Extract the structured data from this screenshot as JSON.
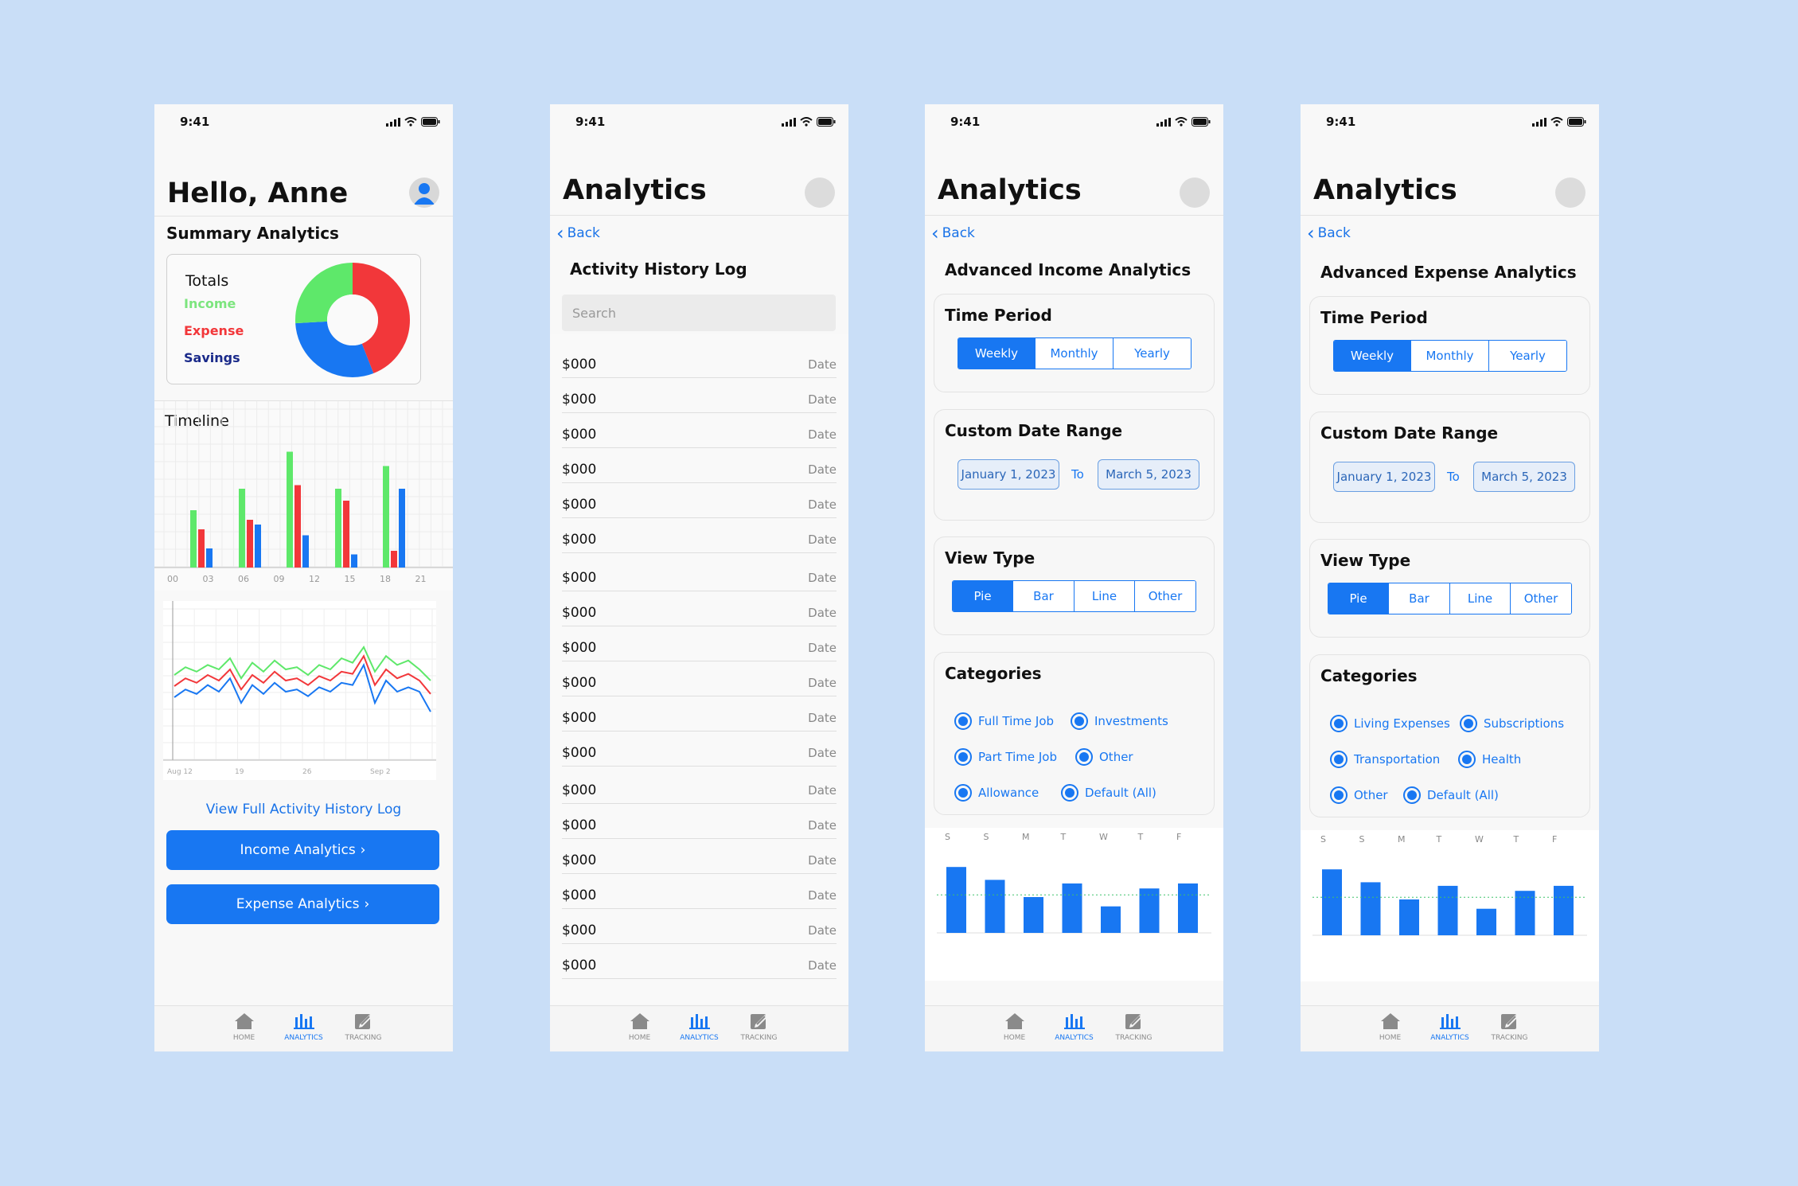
{
  "status_time": "9:41",
  "nav": {
    "home": "HOME",
    "analytics": "ANALYTICS",
    "tracking": "TRACKING"
  },
  "back_label": "Back",
  "colors": {
    "accent": "#1877f2",
    "income": "#5ee86a",
    "expense": "#f2373a",
    "savings": "#1877f2",
    "savings_label": "#1a2a8a",
    "background": "#c9def7"
  },
  "home": {
    "greeting": "Hello, Anne",
    "summary_title": "Summary Analytics",
    "totals": "Totals",
    "legend": {
      "income": "Income",
      "expense": "Expense",
      "savings": "Savings"
    },
    "timeline_title": "Timeline",
    "view_log_link": "View Full Activity History Log",
    "income_btn": "Income Analytics",
    "expense_btn": "Expense Analytics"
  },
  "log": {
    "title": "Analytics",
    "subtitle": "Activity History Log",
    "search_placeholder": "Search",
    "rows": [
      {
        "amount": "$000",
        "date": "Date"
      },
      {
        "amount": "$000",
        "date": "Date"
      },
      {
        "amount": "$000",
        "date": "Date"
      },
      {
        "amount": "$000",
        "date": "Date"
      },
      {
        "amount": "$000",
        "date": "Date"
      },
      {
        "amount": "$000",
        "date": "Date"
      },
      {
        "amount": "$000",
        "date": "Date"
      },
      {
        "amount": "$000",
        "date": "Date"
      },
      {
        "amount": "$000",
        "date": "Date"
      },
      {
        "amount": "$000",
        "date": "Date"
      },
      {
        "amount": "$000",
        "date": "Date"
      },
      {
        "amount": "$000",
        "date": "Date"
      },
      {
        "amount": "$000",
        "date": "Date"
      },
      {
        "amount": "$000",
        "date": "Date"
      },
      {
        "amount": "$000",
        "date": "Date"
      },
      {
        "amount": "$000",
        "date": "Date"
      },
      {
        "amount": "$000",
        "date": "Date"
      },
      {
        "amount": "$000",
        "date": "Date"
      }
    ]
  },
  "income": {
    "title": "Analytics",
    "subtitle": "Advanced Income Analytics",
    "time_period": "Time Period",
    "periods": [
      "Weekly",
      "Monthly",
      "Yearly"
    ],
    "custom_range": "Custom Date Range",
    "date_from": "January 1, 2023",
    "to_label": "To",
    "date_to": "March 5, 2023",
    "view_type": "View Type",
    "views": [
      "Pie",
      "Bar",
      "Line",
      "Other"
    ],
    "categories_title": "Categories",
    "categories": [
      "Full Time Job",
      "Investments",
      "Part Time Job",
      "Other",
      "Allowance",
      "Default (All)"
    ]
  },
  "expense": {
    "title": "Analytics",
    "subtitle": "Advanced Expense Analytics",
    "time_period": "Time Period",
    "periods": [
      "Weekly",
      "Monthly",
      "Yearly"
    ],
    "custom_range": "Custom Date Range",
    "date_from": "January 1, 2023",
    "to_label": "To",
    "date_to": "March 5, 2023",
    "view_type": "View Type",
    "views": [
      "Pie",
      "Bar",
      "Line",
      "Other"
    ],
    "categories_title": "Categories",
    "categories": [
      "Living Expenses",
      "Subscriptions",
      "Transportation",
      "Health",
      "Other",
      "Default (All)"
    ]
  },
  "donut": {
    "income": 26,
    "expense": 44,
    "savings": 30
  },
  "timeline_chart": {
    "type": "bar",
    "categories": [
      "00",
      "03",
      "06",
      "09",
      "12",
      "15",
      "18",
      "21"
    ],
    "series": [
      {
        "name": "Income",
        "values": [
          48,
          66,
          97,
          66,
          85
        ]
      },
      {
        "name": "Expense",
        "values": [
          32,
          40,
          69,
          56,
          14
        ]
      },
      {
        "name": "Savings",
        "values": [
          16,
          36,
          27,
          11,
          66
        ]
      }
    ]
  },
  "line_chart": {
    "type": "line",
    "x_labels": [
      "Aug 12",
      "19",
      "26",
      "Sep 2"
    ],
    "series": [
      {
        "name": "Income",
        "values": [
          55,
          62,
          58,
          64,
          60,
          70,
          52,
          66,
          58,
          68,
          60,
          62,
          55,
          64,
          60,
          70,
          66,
          80,
          58,
          72,
          64,
          68,
          60,
          50
        ]
      },
      {
        "name": "Expense",
        "values": [
          45,
          52,
          48,
          55,
          50,
          60,
          42,
          55,
          48,
          58,
          50,
          52,
          46,
          54,
          50,
          58,
          56,
          72,
          46,
          60,
          52,
          56,
          50,
          38
        ]
      },
      {
        "name": "Savings",
        "values": [
          35,
          42,
          38,
          46,
          40,
          52,
          30,
          46,
          38,
          48,
          40,
          42,
          36,
          44,
          40,
          48,
          46,
          64,
          30,
          50,
          40,
          44,
          40,
          22
        ]
      }
    ]
  },
  "week_chart_income": {
    "type": "bar",
    "categories": [
      "S",
      "S",
      "M",
      "T",
      "W",
      "T",
      "F"
    ],
    "values": [
      92,
      74,
      50,
      69,
      37,
      62,
      69
    ],
    "average": 53
  },
  "week_chart_expense": {
    "type": "bar",
    "categories": [
      "S",
      "S",
      "M",
      "T",
      "W",
      "T",
      "F"
    ],
    "values": [
      92,
      74,
      50,
      69,
      37,
      62,
      69
    ],
    "average": 53
  }
}
